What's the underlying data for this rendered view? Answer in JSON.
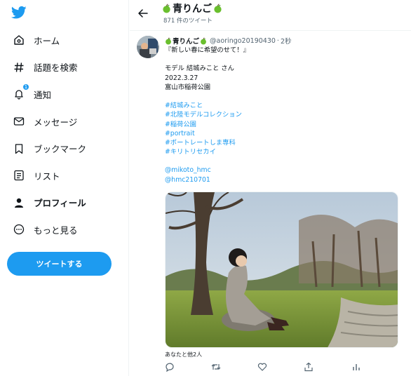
{
  "sidebar": {
    "items": [
      {
        "label": "ホーム",
        "icon": "home-icon"
      },
      {
        "label": "話題を検索",
        "icon": "hashtag-icon"
      },
      {
        "label": "通知",
        "icon": "bell-icon",
        "badge": "1"
      },
      {
        "label": "メッセージ",
        "icon": "envelope-icon"
      },
      {
        "label": "ブックマーク",
        "icon": "bookmark-icon"
      },
      {
        "label": "リスト",
        "icon": "list-icon"
      },
      {
        "label": "プロフィール",
        "icon": "person-icon",
        "active": true
      },
      {
        "label": "もっと見る",
        "icon": "more-icon"
      }
    ],
    "tweet_button": "ツイートする"
  },
  "header": {
    "title": "青りんご",
    "tweet_count": "871 件のツイート"
  },
  "tweet": {
    "name": "青りんご",
    "handle": "@aoringo20190430",
    "dot": "·",
    "time": "2秒",
    "lines": [
      {
        "text": "『新しい春に希望のせて！』",
        "kind": "text"
      },
      {
        "text": "",
        "kind": "blank"
      },
      {
        "text": "モデル 結城みこと さん",
        "kind": "text"
      },
      {
        "text": "2022.3.27",
        "kind": "text"
      },
      {
        "text": "富山市稲荷公園",
        "kind": "text"
      },
      {
        "text": "",
        "kind": "blank"
      },
      {
        "text": "#結城みこと",
        "kind": "link"
      },
      {
        "text": "#北陸モデルコレクション",
        "kind": "link"
      },
      {
        "text": "#稲荷公園",
        "kind": "link"
      },
      {
        "text": "#portrait",
        "kind": "link"
      },
      {
        "text": "#ポートレートしま専科",
        "kind": "link"
      },
      {
        "text": "#キリトリセカイ",
        "kind": "link"
      },
      {
        "text": "",
        "kind": "blank"
      },
      {
        "text": "@mikoto_hmc",
        "kind": "link"
      },
      {
        "text": "@hmc210701",
        "kind": "link"
      }
    ],
    "liked_by": "あなたと他2人"
  },
  "colors": {
    "accent": "#1d9bf0",
    "text": "#0f1419",
    "muted": "#536471",
    "apple": "#6abf2e"
  }
}
